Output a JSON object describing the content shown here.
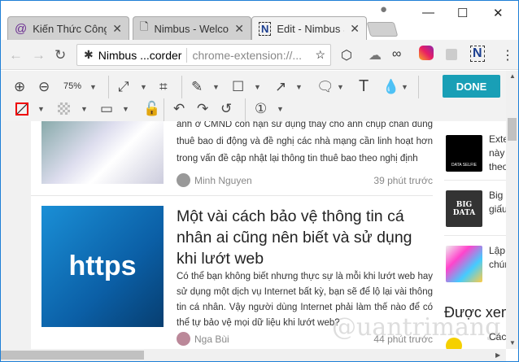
{
  "tabs": [
    {
      "label": "Kiến Thức Công",
      "icon": "quantrimang-icon"
    },
    {
      "label": "Nimbus - Welco",
      "icon": "page-icon"
    },
    {
      "label": "Edit - Nimbus S",
      "icon": "nimbus-icon",
      "active": true
    }
  ],
  "address": {
    "site_label": "Nimbus ...corder",
    "url": "chrome-extension://..."
  },
  "zoom": "75%",
  "done_label": "DONE",
  "accent_color": "#199fb6",
  "articles": [
    {
      "excerpt": "ảnh ở CMND còn hạn sử dụng thay cho ảnh chụp chân dung thuê bao di động và đề nghị các nhà mạng cần linh hoạt hơn trong vấn đề cập nhật lại thông tin thuê bao theo nghị định",
      "author": "Minh Nguyen",
      "time": "39 phút trước"
    },
    {
      "title": "Một vài cách bảo vệ thông tin cá nhân ai cũng nên biết và sử dụng khi lướt web",
      "image_text": "https",
      "excerpt": "Có thể bạn không biết nhưng thực sự là mỗi khi lướt web hay sử dụng một dịch vụ Internet bất kỳ, bạn sẽ để lộ lại vài thông tin cá nhân. Vậy người dùng Internet phải làm thế nào để có thể tự bảo vệ mọi dữ liệu khi lướt web?",
      "author": "Nga Bùi",
      "time": "44 phút trước"
    }
  ],
  "sidebar": {
    "items": [
      {
        "line1": "Exte",
        "line2": "này",
        "line3": "theo",
        "thumb_text": "DATA SELFIE"
      },
      {
        "line1": "Big",
        "line2": "giấu",
        "thumb_text": "BIG DATA"
      },
      {
        "line1": "Lập",
        "line2": "chún"
      }
    ],
    "heading": "Được xem",
    "next_item": "Các"
  },
  "watermark": "Quantrimang"
}
